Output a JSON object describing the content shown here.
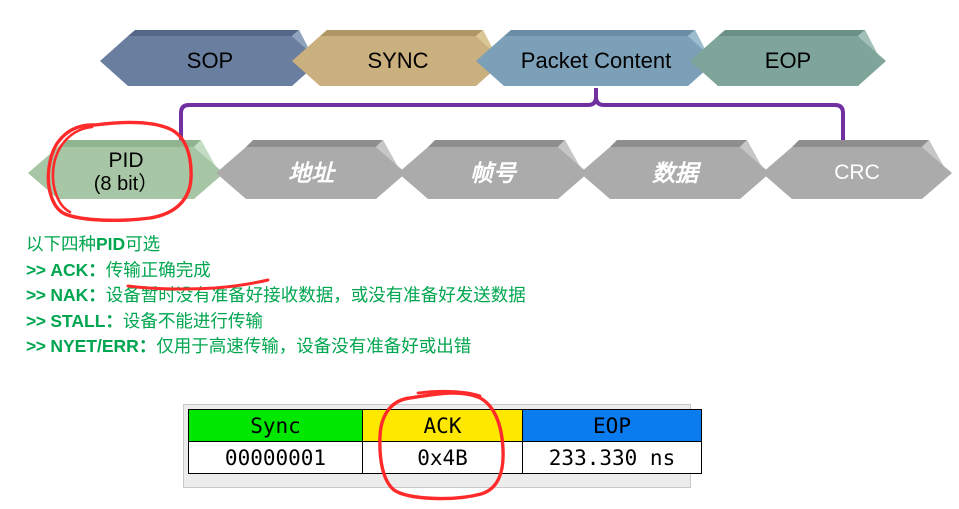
{
  "top_row": {
    "name": "usb-packet-frame",
    "blocks": [
      {
        "id": "sop",
        "label": "SOP",
        "fill": "#6A7FA0",
        "bevel_top": "#55688A",
        "bevel_tip": "#8FA3BE"
      },
      {
        "id": "sync",
        "label": "SYNC",
        "fill": "#C9B07E",
        "bevel_top": "#AF9765",
        "bevel_tip": "#DBC696"
      },
      {
        "id": "content",
        "label": "Packet Content",
        "fill": "#7BA0B8",
        "bevel_top": "#6A8CA4",
        "bevel_tip": "#9CBCD0"
      },
      {
        "id": "eop",
        "label": "EOP",
        "fill": "#7FA59B",
        "bevel_top": "#6B9086",
        "bevel_tip": "#A3C0B8"
      }
    ]
  },
  "bottom_row": {
    "name": "packet-content-fields",
    "blocks": [
      {
        "id": "pid",
        "label": "PID",
        "sublabel": "(8 bit）",
        "fill": "#A7C6A6",
        "bevel_top": "#90B390",
        "bevel_tip": "#C5DCC4",
        "style": "dark"
      },
      {
        "id": "addr",
        "label": "地址",
        "fill": "#ABABAB",
        "bevel_top": "#8E8E8E",
        "bevel_tip": "#C6C6C6",
        "style": "white-italic"
      },
      {
        "id": "frame",
        "label": "帧号",
        "fill": "#ABABAB",
        "bevel_top": "#8E8E8E",
        "bevel_tip": "#C6C6C6",
        "style": "white-italic"
      },
      {
        "id": "data",
        "label": "数据",
        "fill": "#ABABAB",
        "bevel_top": "#8E8E8E",
        "bevel_tip": "#C6C6C6",
        "style": "white-italic"
      },
      {
        "id": "crc",
        "label": "CRC",
        "fill": "#ABABAB",
        "bevel_top": "#8E8E8E",
        "bevel_tip": "#C6C6C6",
        "style": "white-plain"
      }
    ]
  },
  "connector": {
    "name": "packet-content-brace",
    "color": "#7030A0",
    "width": 4
  },
  "notes": {
    "color": "#00A64F",
    "heading_prefix": "以下四种",
    "heading_bold": "PID",
    "heading_suffix": "可选",
    "lines": [
      {
        "arrow": ">>",
        "key": "ACK",
        "sep": "：",
        "text": "传输正确完成"
      },
      {
        "arrow": ">>",
        "key": "NAK",
        "sep": "：",
        "text": "设备暂时没有准备好接收数据，或没有准备好发送数据"
      },
      {
        "arrow": ">>",
        "key": "STALL",
        "sep": "：",
        "text": "设备不能进行传输"
      },
      {
        "arrow": ">>",
        "key": "NYET/ERR",
        "sep": "：",
        "text": "仅用于高速传输，设备没有准备好或出错"
      }
    ]
  },
  "capture_table": {
    "name": "packet-capture-table",
    "headers": [
      {
        "label": "Sync",
        "bg": "#00E800",
        "fg": "#000000"
      },
      {
        "label": "ACK",
        "bg": "#FFE800",
        "fg": "#000000"
      },
      {
        "label": "EOP",
        "bg": "#0A7CF0",
        "fg": "#FFFFFF"
      }
    ],
    "values": [
      "00000001",
      "0x4B",
      "233.330 ns"
    ]
  },
  "annotations": {
    "ink_color": "#FF2A2A",
    "marks": [
      {
        "id": "circle-pid",
        "kind": "ellipse-scribble",
        "target": "PID block"
      },
      {
        "id": "underline-ack",
        "kind": "underline",
        "target": "传输正确完成"
      },
      {
        "id": "circle-ack-cell",
        "kind": "ellipse-scribble",
        "target": "ACK / 0x4B column"
      }
    ]
  }
}
